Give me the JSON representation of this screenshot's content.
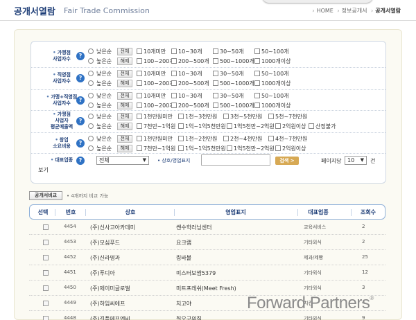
{
  "header": {
    "title": "공개서열람",
    "subtitle": "Fair Trade Commission",
    "breadcrumb": [
      "HOME",
      "정보공개서",
      "공개서열람"
    ]
  },
  "filters": {
    "radio_low": "낮은순",
    "radio_high": "높은순",
    "btn_all": "전체",
    "btn_clear": "해제",
    "rows": [
      {
        "label_lines": [
          "가맹점",
          "사업자수"
        ],
        "opts_top": [
          "10개미만",
          "10~30개",
          "30~50개",
          "50~100개"
        ],
        "opts_bottom": [
          "100~200개",
          "200~500개",
          "500~1000개",
          "1000개이상"
        ]
      },
      {
        "label_lines": [
          "직영점",
          "사업자수"
        ],
        "opts_top": [
          "10개미만",
          "10~30개",
          "30~50개",
          "50~100개"
        ],
        "opts_bottom": [
          "100~200개",
          "200~500개",
          "500~1000개",
          "1000개이상"
        ]
      },
      {
        "label_lines": [
          "가맹+직영점",
          "사업자수"
        ],
        "opts_top": [
          "10개미만",
          "10~30개",
          "30~50개",
          "50~100개"
        ],
        "opts_bottom": [
          "100~200개",
          "200~500개",
          "500~1000개",
          "1000개이상"
        ]
      },
      {
        "label_lines": [
          "가맹점",
          "사업자",
          "평균매출액"
        ],
        "opts_top": [
          "1천만원미만",
          "1천~3천만원",
          "3천~5천만원",
          "5천~7천만원"
        ],
        "opts_bottom": [
          "7천만~1억원",
          "1억~1억5천만원",
          "1억5천만~2억원",
          "2억원이상",
          "산정불가"
        ]
      },
      {
        "label_lines": [
          "창업",
          "소요비용"
        ],
        "opts_top": [
          "1천만원미만",
          "1천~2천만원",
          "2천~4천만원",
          "4천~7천만원"
        ],
        "opts_bottom": [
          "7천만~1억원",
          "1억~1억5천만원",
          "1억5천만~2억원",
          "2억원이상"
        ]
      }
    ],
    "industry_label": "대표업종",
    "industry_value": "전체",
    "search_label": "상호/영업표지",
    "search_value": "",
    "search_button": "검색 >",
    "per_page_label": "페이지당",
    "per_page_value": "10",
    "per_page_suffix": "건",
    "per_page_suffix2": "보기"
  },
  "compare": {
    "button": "공개서비교",
    "note": "• 4개까지 비교 가능"
  },
  "table": {
    "headers": [
      "선택",
      "번호",
      "상호",
      "영업표지",
      "대표업종",
      "조회수"
    ],
    "rows": [
      {
        "no": "4454",
        "company": "(주)신사고아카데미",
        "brand": "쎈수학러닝센터",
        "industry": "교육서비스",
        "views": "2"
      },
      {
        "no": "4453",
        "company": "(주)모심푸드",
        "brand": "요크랩",
        "industry": "기타외식",
        "views": "2"
      },
      {
        "no": "4452",
        "company": "(주)신라명과",
        "brand": "링바볼",
        "industry": "제과/제빵",
        "views": "25"
      },
      {
        "no": "4451",
        "company": "(주)푸디아",
        "brand": "미스터보쌈5379",
        "industry": "기타외식",
        "views": "12"
      },
      {
        "no": "4450",
        "company": "(주)제이미글로벌",
        "brand": "미트프레쉬(Meet Fresh)",
        "industry": "기타외식",
        "views": "3"
      },
      {
        "no": "4449",
        "company": "(주)하임씨에프",
        "brand": "치고야",
        "industry": "치킨",
        "views": "4"
      },
      {
        "no": "4448",
        "company": "(주)길픔에프엔비",
        "brand": "칠오구의집",
        "industry": "기타외식",
        "views": "9"
      }
    ]
  },
  "watermark": {
    "text": "Forward Partners",
    "mark": "®"
  }
}
